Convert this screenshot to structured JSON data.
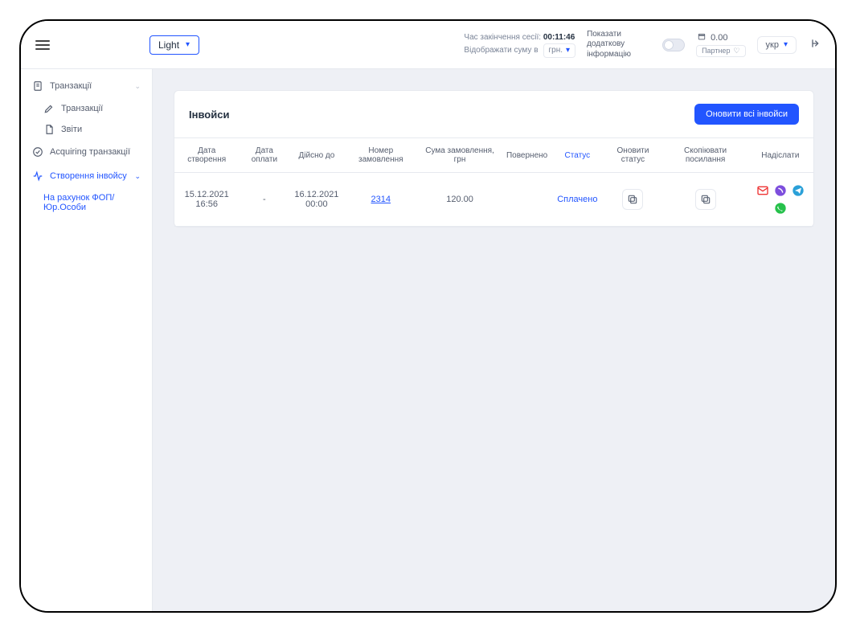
{
  "topbar": {
    "theme_value": "Light",
    "session_label": "Час закінчення сесії:",
    "session_time": "00:11:46",
    "amount_in_label": "Відображати суму в",
    "currency_value": "грн.",
    "extra_info_label": "Показати додаткову інформацію",
    "balance_value": "0.00",
    "partner_label": "Партнер",
    "lang_value": "укр"
  },
  "sidebar": {
    "transactions_group": "Транзакції",
    "transactions_item": "Транзакції",
    "reports_item": "Звіти",
    "acquiring_group": "Acquiring транзакції",
    "invoice_group": "Створення інвойсу",
    "invoice_sub": "На рахунок ФОП/Юр.Особи"
  },
  "panel": {
    "title": "Інвойси",
    "refresh_label": "Оновити всі інвойси"
  },
  "columns": {
    "created": "Дата створення",
    "paid": "Дата оплати",
    "valid": "Дійсно до",
    "order": "Номер замовлення",
    "amount": "Сума замовлення, грн",
    "refunded": "Повернено",
    "status": "Статус",
    "update_status": "Оновити статус",
    "copy_link": "Скопіювати посилання",
    "send": "Надіслати"
  },
  "rows": [
    {
      "created": "15.12.2021 16:56",
      "paid": "-",
      "valid": "16.12.2021 00:00",
      "order": "2314",
      "amount": "120.00",
      "refunded": "",
      "status": "Сплачено"
    }
  ]
}
